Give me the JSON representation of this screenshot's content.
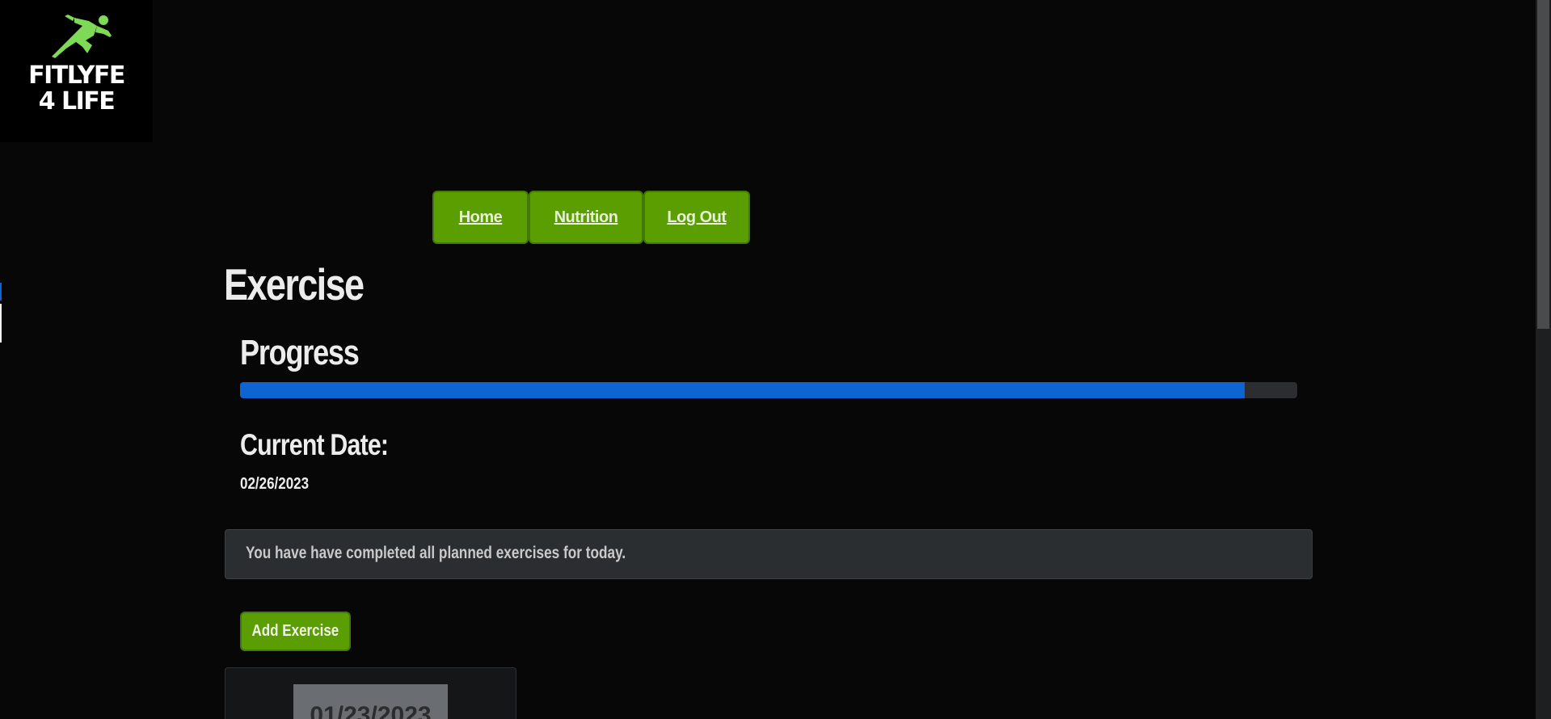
{
  "brand": {
    "name_line1": "FITLYFE",
    "name_line2": "4 LIFE",
    "logo_icon": "running-man-icon",
    "logo_color": "#7ed957"
  },
  "nav": {
    "items": [
      {
        "label": "Home"
      },
      {
        "label": "Nutrition"
      },
      {
        "label": "Log Out"
      }
    ]
  },
  "page": {
    "title": "Exercise",
    "progress_heading": "Progress",
    "progress_percent": 95,
    "current_date_label": "Current Date:",
    "current_date_value": "02/26/2023",
    "alert_message": "You have have completed all planned exercises for today.",
    "add_exercise_label": "Add Exercise",
    "card_date": "01/23/2023"
  },
  "colors": {
    "background": "#070708",
    "accent_green": "#5a9e02",
    "progress_blue": "#0d64d2"
  }
}
